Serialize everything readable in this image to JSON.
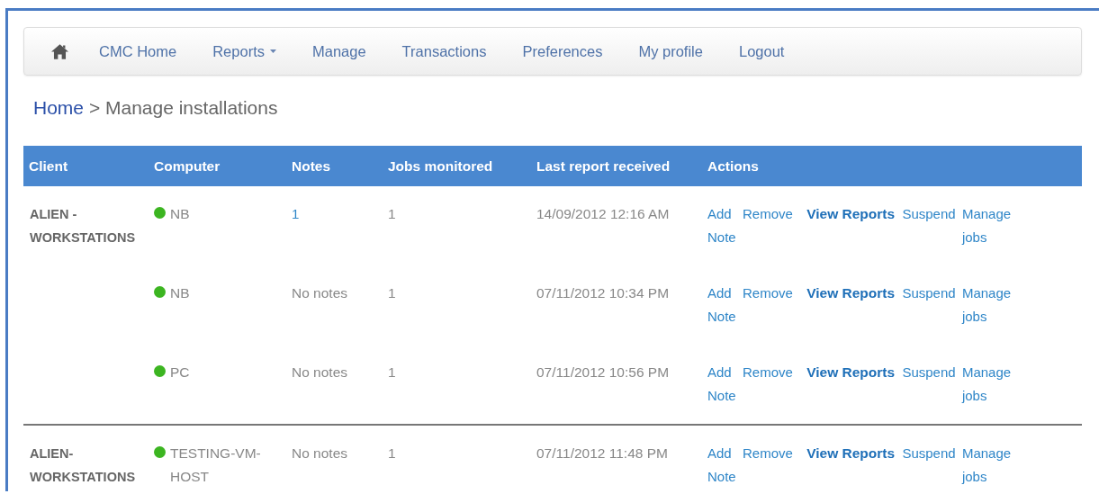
{
  "nav": {
    "items": [
      {
        "label": "CMC Home",
        "dropdown": false
      },
      {
        "label": "Reports",
        "dropdown": true
      },
      {
        "label": "Manage",
        "dropdown": false
      },
      {
        "label": "Transactions",
        "dropdown": false
      },
      {
        "label": "Preferences",
        "dropdown": false
      },
      {
        "label": "My profile",
        "dropdown": false
      },
      {
        "label": "Logout",
        "dropdown": false
      }
    ]
  },
  "breadcrumb": {
    "link": "Home",
    "separator": ">",
    "current": "Manage installations"
  },
  "table": {
    "columns": [
      "Client",
      "Computer",
      "Notes",
      "Jobs monitored",
      "Last report received",
      "Actions"
    ],
    "groups": [
      {
        "client": "ALIEN - WORKSTATIONS",
        "installations": [
          {
            "computer": "NB",
            "color": "#3cb521",
            "notes": "1",
            "notes_link": true,
            "jobs": "1",
            "last_report": "14/09/2012 12:16 AM",
            "actions": [
              {
                "label": "Add Note",
                "kind": "link"
              },
              {
                "label": "Remove",
                "kind": "link"
              },
              {
                "label": "View Reports",
                "kind": "primary"
              },
              {
                "label": "Suspend",
                "kind": "link"
              },
              {
                "label": "Manage jobs",
                "kind": "link"
              }
            ]
          },
          {
            "computer": "NB",
            "color": "#3cb521",
            "notes": "No notes",
            "notes_link": false,
            "jobs": "1",
            "last_report": "07/11/2012 10:34 PM",
            "actions": [
              {
                "label": "Add Note",
                "kind": "link"
              },
              {
                "label": "Remove",
                "kind": "link"
              },
              {
                "label": "View Reports",
                "kind": "primary"
              },
              {
                "label": "Suspend",
                "kind": "link"
              },
              {
                "label": "Manage jobs",
                "kind": "link"
              }
            ]
          },
          {
            "computer": "PC",
            "color": "#3cb521",
            "notes": "No notes",
            "notes_link": false,
            "jobs": "1",
            "last_report": "07/11/2012 10:56 PM",
            "actions": [
              {
                "label": "Add Note",
                "kind": "link"
              },
              {
                "label": "Remove",
                "kind": "link"
              },
              {
                "label": "View Reports",
                "kind": "primary"
              },
              {
                "label": "Suspend",
                "kind": "link"
              },
              {
                "label": "Manage jobs",
                "kind": "link"
              }
            ]
          }
        ]
      },
      {
        "client": "ALIEN-WORKSTATIONS",
        "installations": [
          {
            "computer": "TESTING-VM-HOST",
            "color": "#3cb521",
            "notes": "No notes",
            "notes_link": false,
            "jobs": "1",
            "last_report": "07/11/2012 11:48 PM",
            "actions": [
              {
                "label": "Add Note",
                "kind": "link"
              },
              {
                "label": "Remove",
                "kind": "link"
              },
              {
                "label": "View Reports",
                "kind": "primary"
              },
              {
                "label": "Suspend",
                "kind": "link"
              },
              {
                "label": "Manage jobs",
                "kind": "link"
              }
            ]
          }
        ]
      }
    ]
  }
}
